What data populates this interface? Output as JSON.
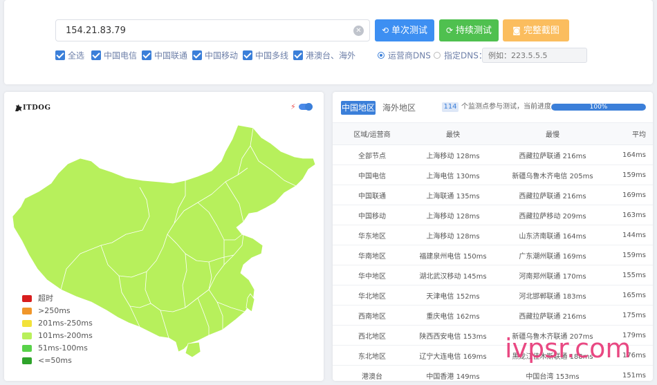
{
  "search": {
    "ip": "154.21.83.79"
  },
  "buttons": {
    "single": "单次测试",
    "continuous": "持续测试",
    "screenshot": "完整截图"
  },
  "filters": [
    {
      "label": "全选",
      "checked": true
    },
    {
      "label": "中国电信",
      "checked": true
    },
    {
      "label": "中国联通",
      "checked": true
    },
    {
      "label": "中国移动",
      "checked": true
    },
    {
      "label": "中国多线",
      "checked": true
    },
    {
      "label": "港澳台、海外",
      "checked": true
    }
  ],
  "dns": {
    "option_isp": "运营商DNS",
    "option_custom": "指定DNS：",
    "placeholder": "例如：223.5.5.5",
    "selected": "isp"
  },
  "logo": {
    "text": "ITDOG"
  },
  "legend": [
    {
      "label": "超时",
      "color": "#d81e1e"
    },
    {
      "label": ">250ms",
      "color": "#f0962a"
    },
    {
      "label": "201ms-250ms",
      "color": "#f2e23a"
    },
    {
      "label": "101ms-200ms",
      "color": "#b8f05a"
    },
    {
      "label": "51ms-100ms",
      "color": "#58d24a"
    },
    {
      "label": "<=50ms",
      "color": "#2ea32a"
    }
  ],
  "map": {
    "fill_color": "#b7f05c",
    "border_color": "#ffffff"
  },
  "tabs": {
    "china": "中国地区",
    "overseas": "海外地区",
    "active": "china"
  },
  "progress": {
    "count": "114",
    "text": "个监测点参与测试，当前进度：",
    "value": 100,
    "label": "100%"
  },
  "table": {
    "headers": {
      "region": "区域/运营商",
      "fastest": "最快",
      "slowest": "最慢",
      "avg": "平均"
    },
    "rows": [
      {
        "region": "全部节点",
        "fastest": "上海移动 128ms",
        "slowest": "西藏拉萨联通 216ms",
        "avg": "164ms"
      },
      {
        "region": "中国电信",
        "fastest": "上海电信 130ms",
        "slowest": "新疆乌鲁木齐电信 205ms",
        "avg": "159ms"
      },
      {
        "region": "中国联通",
        "fastest": "上海联通 135ms",
        "slowest": "西藏拉萨联通 216ms",
        "avg": "169ms"
      },
      {
        "region": "中国移动",
        "fastest": "上海移动 128ms",
        "slowest": "西藏拉萨移动 209ms",
        "avg": "163ms"
      },
      {
        "region": "华东地区",
        "fastest": "上海移动 128ms",
        "slowest": "山东济南联通 164ms",
        "avg": "144ms"
      },
      {
        "region": "华南地区",
        "fastest": "福建泉州电信 150ms",
        "slowest": "广东潮州联通 169ms",
        "avg": "159ms"
      },
      {
        "region": "华中地区",
        "fastest": "湖北武汉移动 145ms",
        "slowest": "河南郑州联通 170ms",
        "avg": "155ms"
      },
      {
        "region": "华北地区",
        "fastest": "天津电信 152ms",
        "slowest": "河北邯郸联通 183ms",
        "avg": "165ms"
      },
      {
        "region": "西南地区",
        "fastest": "重庆电信 162ms",
        "slowest": "西藏拉萨联通 216ms",
        "avg": "175ms"
      },
      {
        "region": "西北地区",
        "fastest": "陕西西安电信 153ms",
        "slowest": "新疆乌鲁木齐联通 207ms",
        "avg": "179ms"
      },
      {
        "region": "东北地区",
        "fastest": "辽宁大连电信 169ms",
        "slowest": "黑龙江佳木斯联通 188ms",
        "avg": "176ms"
      },
      {
        "region": "港澳台",
        "fastest": "中国香港 149ms",
        "slowest": "中国台湾 153ms",
        "avg": "151ms"
      }
    ]
  },
  "watermark": "ivpsr.com"
}
